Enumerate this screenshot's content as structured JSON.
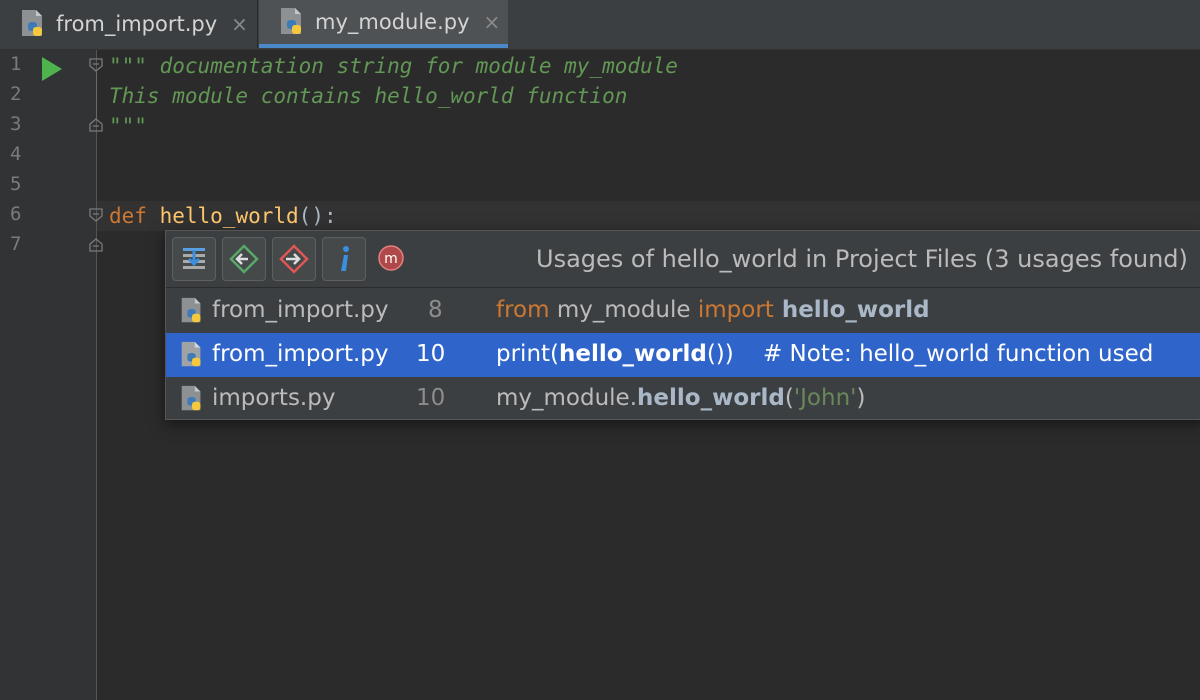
{
  "tabs": [
    {
      "label": "from_import.py",
      "active": false
    },
    {
      "label": "my_module.py",
      "active": true
    }
  ],
  "tab_close_glyph": "×",
  "line_numbers": [
    "1",
    "2",
    "3",
    "4",
    "5",
    "6",
    "7"
  ],
  "code": {
    "line1": "\"\"\" documentation string for module my_module",
    "line2": "This module contains hello_world function",
    "line3": "\"\"\"",
    "line6_kw": "def",
    "line6_fn": "hello_world",
    "line6_rest": "():"
  },
  "popup": {
    "title": "Usages of hello_world in Project Files (3 usages found)",
    "toolbar_icons": [
      "settings-icon",
      "previous-usage-icon",
      "next-usage-icon",
      "info-icon",
      "module-icon"
    ],
    "rows": [
      {
        "file": "from_import.py",
        "line": "8",
        "code": {
          "k1": "from",
          "p1": " my_module ",
          "k2": "import",
          "b1": " hello_world"
        },
        "selected": false
      },
      {
        "file": "from_import.py",
        "line": "10",
        "code": {
          "p1": "print(",
          "b1": "hello_world",
          "p2": "())",
          "c1": "    # Note: hello_world function used"
        },
        "selected": true
      },
      {
        "file": "imports.py",
        "line": "10",
        "code": {
          "p1": "my_module.",
          "b1": "hello_world",
          "p2": "(",
          "s1": "'John'",
          "p3": ")"
        },
        "selected": false
      }
    ]
  },
  "colors": {
    "background": "#2b2b2b",
    "docstring": "#629755",
    "keyword": "#cc7832",
    "function": "#ffc66d",
    "selection": "#2f65ca",
    "active_tab_underline": "#4a88c7",
    "run_icon": "#4fb34d"
  }
}
